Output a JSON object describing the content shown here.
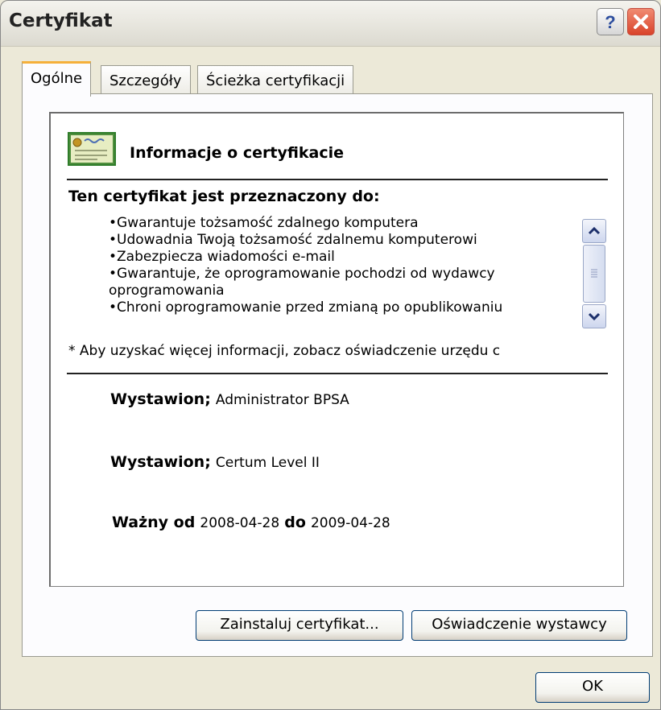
{
  "window": {
    "title": "Certyfikat"
  },
  "tabs": [
    {
      "label": "Ogólne"
    },
    {
      "label": "Szczegóły"
    },
    {
      "label": "Ścieżka certyfikacji"
    }
  ],
  "info": {
    "heading": "Informacje o certyfikacie",
    "purpose_title": "Ten certyfikat jest przeznaczony do:",
    "purposes": [
      "•Gwarantuje tożsamość zdalnego komputera",
      "•Udowadnia Twoją tożsamość zdalnemu komputerowi",
      "•Zabezpiecza wiadomości e-mail",
      "•Gwarantuje, że oprogramowanie pochodzi od wydawcy",
      "oprogramowania",
      "•Chroni oprogramowanie przed zmianą po opublikowaniu"
    ],
    "footnote": "* Aby uzyskać więcej informacji, zobacz oświadczenie urzędu c",
    "issued_to_label": "Wystawion;",
    "issued_to_value": "Administrator BPSA",
    "issued_by_label": "Wystawion;",
    "issued_by_value": "Certum Level II",
    "valid_from_label": "Ważny od",
    "valid_from_value": "2008-04-28",
    "valid_to_label": "do",
    "valid_to_value": "2009-04-28"
  },
  "buttons": {
    "install": "Zainstaluj certyfikat...",
    "statement": "Oświadczenie wystawcy",
    "ok": "OK"
  },
  "icons": {
    "help": "help-icon",
    "close": "close-icon",
    "certificate": "certificate-icon"
  }
}
